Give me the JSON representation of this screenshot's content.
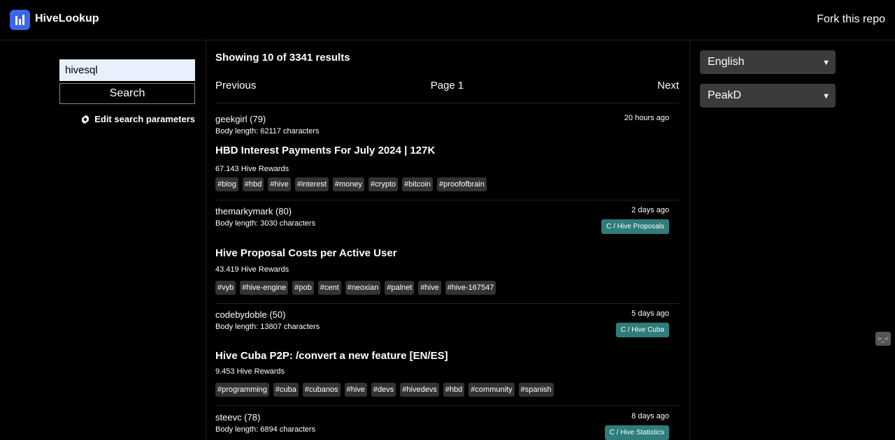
{
  "header": {
    "brand": "HiveLookup",
    "fork_link": "Fork this repo"
  },
  "search": {
    "value": "hivesql",
    "button_label": "Search",
    "edit_params_label": "Edit search parameters"
  },
  "results": {
    "showing": "Showing 10 of 3341 results",
    "prev": "Previous",
    "page": "Page 1",
    "next": "Next"
  },
  "posts": [
    {
      "author": "geekgirl (79)",
      "age": "20 hours ago",
      "body_length": "Body length: 62117 characters",
      "community": "",
      "title": "HBD Interest Payments For July 2024 | 127K",
      "rewards": "67.143 Hive Rewards",
      "tags": [
        "#blog",
        "#hbd",
        "#hive",
        "#interest",
        "#money",
        "#crypto",
        "#bitcoin",
        "#proofofbrain"
      ]
    },
    {
      "author": "themarkymark (80)",
      "age": "2 days ago",
      "body_length": "Body length: 3030 characters",
      "community": "C / Hive Proposals",
      "title": "Hive Proposal Costs per Active User",
      "rewards": "43.419 Hive Rewards",
      "tags": [
        "#vyb",
        "#hive-engine",
        "#pob",
        "#cent",
        "#neoxian",
        "#palnet",
        "#hive",
        "#hive-167547"
      ]
    },
    {
      "author": "codebydoble (50)",
      "age": "5 days ago",
      "body_length": "Body length: 13807 characters",
      "community": "C / Hive Cuba",
      "title": "Hive Cuba P2P: /convert a new feature [EN/ES]",
      "rewards": "9.453 Hive Rewards",
      "tags": [
        "#programming",
        "#cuba",
        "#cubanos",
        "#hive",
        "#devs",
        "#hivedevs",
        "#hbd",
        "#community",
        "#spanish"
      ]
    },
    {
      "author": "steevc (78)",
      "age": "8 days ago",
      "body_length": "Body length: 6894 characters",
      "community": "C / Hive Statistics",
      "title": "",
      "rewards": "",
      "tags": []
    }
  ],
  "settings": {
    "language": "English",
    "frontend": "PeakD"
  },
  "overlay_badge": ">_<",
  "colors": {
    "community_badge": "#2e7d7a",
    "tag_bg": "#333333",
    "logo": "#3a66e8",
    "input_bg": "#e8f0fe"
  }
}
